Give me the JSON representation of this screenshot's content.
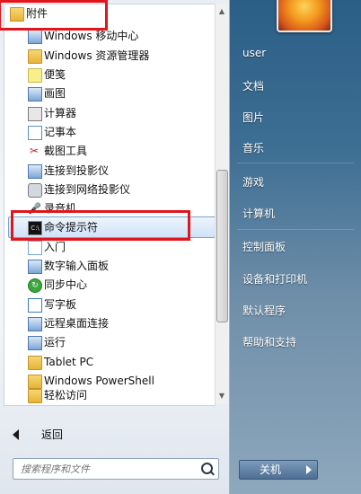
{
  "programs": {
    "items": [
      {
        "label": "附件",
        "icon": "folder-icon"
      },
      {
        "label": "Windows 移动中心",
        "icon": "mobility-center-icon"
      },
      {
        "label": "Windows 资源管理器",
        "icon": "explorer-folder-icon"
      },
      {
        "label": "便笺",
        "icon": "sticky-notes-icon"
      },
      {
        "label": "画图",
        "icon": "paint-icon"
      },
      {
        "label": "计算器",
        "icon": "calculator-icon"
      },
      {
        "label": "记事本",
        "icon": "notepad-icon"
      },
      {
        "label": "截图工具",
        "icon": "snipping-tool-icon"
      },
      {
        "label": "连接到投影仪",
        "icon": "projector-icon"
      },
      {
        "label": "连接到网络投影仪",
        "icon": "network-projector-icon"
      },
      {
        "label": "录音机",
        "icon": "microphone-icon"
      },
      {
        "label": "命令提示符",
        "icon": "cmd-icon"
      },
      {
        "label": "入门",
        "icon": "getting-started-icon"
      },
      {
        "label": "数字输入面板",
        "icon": "input-panel-icon"
      },
      {
        "label": "同步中心",
        "icon": "sync-center-icon"
      },
      {
        "label": "写字板",
        "icon": "wordpad-icon"
      },
      {
        "label": "远程桌面连接",
        "icon": "remote-desktop-icon"
      },
      {
        "label": "运行",
        "icon": "run-icon"
      },
      {
        "label": "Tablet PC",
        "icon": "folder-icon"
      },
      {
        "label": "Windows PowerShell",
        "icon": "folder-icon"
      },
      {
        "label": "轻松访问",
        "icon": "folder-icon"
      }
    ]
  },
  "back_label": "返回",
  "search": {
    "placeholder": "搜索程序和文件"
  },
  "right": {
    "items": [
      "user",
      "文档",
      "图片",
      "音乐",
      "游戏",
      "计算机",
      "控制面板",
      "设备和打印机",
      "默认程序",
      "帮助和支持"
    ]
  },
  "shutdown_label": "关机",
  "colors": {
    "highlight_box": "#e0161c",
    "selection": "#cfe2f8"
  }
}
